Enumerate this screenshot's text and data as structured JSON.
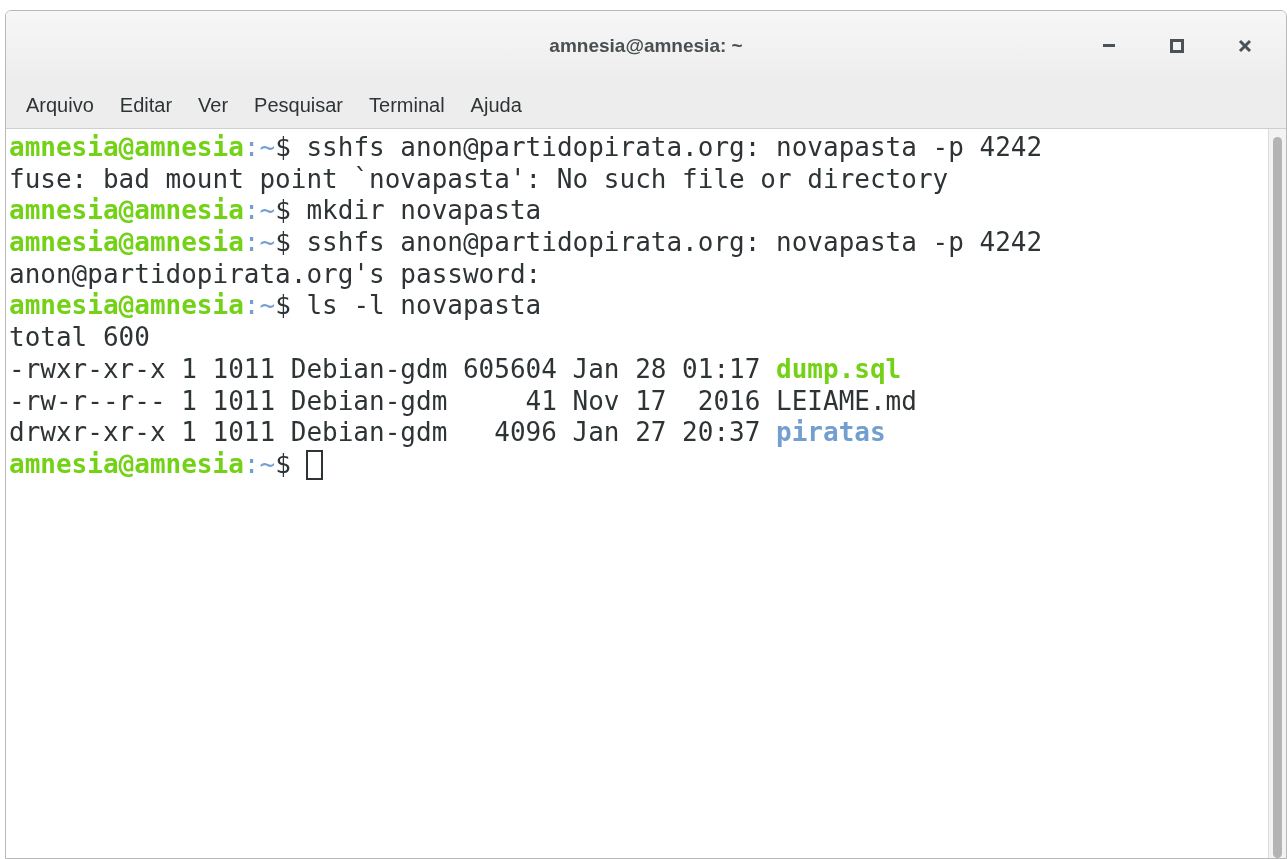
{
  "window": {
    "title": "amnesia@amnesia: ~"
  },
  "menu": [
    "Arquivo",
    "Editar",
    "Ver",
    "Pesquisar",
    "Terminal",
    "Ajuda"
  ],
  "terminal": {
    "lines": [
      {
        "segments": [
          {
            "kind": "user",
            "text": "amnesia@amnesia"
          },
          {
            "kind": "path",
            "text": ":~"
          },
          {
            "kind": "text",
            "text": "$ sshfs anon@partidopirata.org: novapasta -p 4242"
          }
        ]
      },
      {
        "segments": [
          {
            "kind": "text",
            "text": "fuse: bad mount point `novapasta': No such file or directory"
          }
        ]
      },
      {
        "segments": [
          {
            "kind": "user",
            "text": "amnesia@amnesia"
          },
          {
            "kind": "path",
            "text": ":~"
          },
          {
            "kind": "text",
            "text": "$ mkdir novapasta"
          }
        ]
      },
      {
        "segments": [
          {
            "kind": "user",
            "text": "amnesia@amnesia"
          },
          {
            "kind": "path",
            "text": ":~"
          },
          {
            "kind": "text",
            "text": "$ sshfs anon@partidopirata.org: novapasta -p 4242"
          }
        ]
      },
      {
        "segments": [
          {
            "kind": "text",
            "text": "anon@partidopirata.org's password:"
          }
        ]
      },
      {
        "segments": [
          {
            "kind": "user",
            "text": "amnesia@amnesia"
          },
          {
            "kind": "path",
            "text": ":~"
          },
          {
            "kind": "text",
            "text": "$ ls -l novapasta"
          }
        ]
      },
      {
        "segments": [
          {
            "kind": "text",
            "text": "total 600"
          }
        ]
      },
      {
        "segments": [
          {
            "kind": "text",
            "text": "-rwxr-xr-x 1 1011 Debian-gdm 605604 Jan 28 01:17 "
          },
          {
            "kind": "exec",
            "text": "dump.sql"
          }
        ]
      },
      {
        "segments": [
          {
            "kind": "text",
            "text": "-rw-r--r-- 1 1011 Debian-gdm     41 Nov 17  2016 LEIAME.md"
          }
        ]
      },
      {
        "segments": [
          {
            "kind": "text",
            "text": "drwxr-xr-x 1 1011 Debian-gdm   4096 Jan 27 20:37 "
          },
          {
            "kind": "dir",
            "text": "piratas"
          }
        ]
      },
      {
        "segments": [
          {
            "kind": "user",
            "text": "amnesia@amnesia"
          },
          {
            "kind": "path",
            "text": ":~"
          },
          {
            "kind": "text",
            "text": "$ "
          }
        ],
        "cursor": true
      }
    ]
  }
}
